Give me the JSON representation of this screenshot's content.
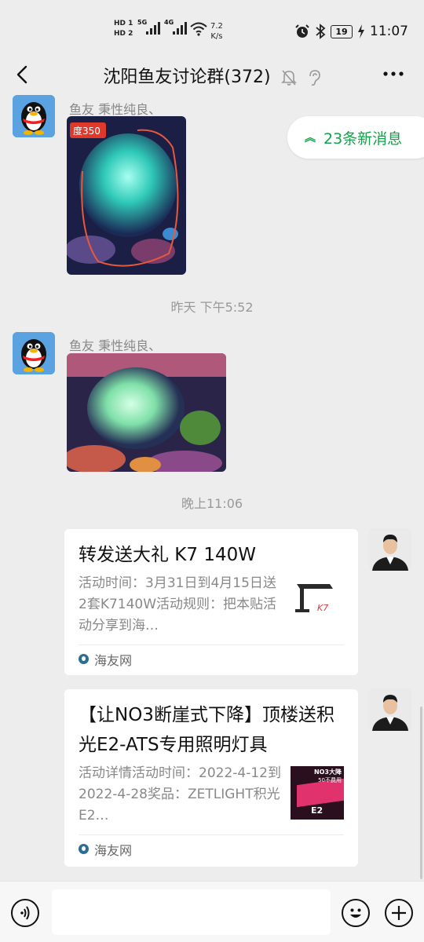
{
  "status_bar": {
    "hd1": "HD 1",
    "hd2": "HD 2",
    "net1": "5G",
    "net2": "4G",
    "speed_value": "7.2",
    "speed_unit": "K/s",
    "battery": "19",
    "time": "11:07"
  },
  "header": {
    "title": "沈阳鱼友讨论群(372)",
    "icons": [
      "back-icon",
      "mute-bell-icon",
      "ear-icon",
      "more-icon"
    ]
  },
  "new_messages_label": "23条新消息",
  "messages": [
    {
      "type": "image",
      "sender": "鱼友 秉性纯良、",
      "image_tag": "度350"
    },
    {
      "type": "time",
      "text": "昨天 下午5:52"
    },
    {
      "type": "image",
      "sender": "鱼友 秉性纯良、"
    },
    {
      "type": "time",
      "text": "晚上11:06"
    },
    {
      "type": "link_card",
      "title": "转发送大礼 K7 140W",
      "desc": "活动时间：3月31日到4月15日送2套K7140W活动规则：把本贴活动分享到海…",
      "source": "海友网"
    },
    {
      "type": "link_card",
      "title": "【让NO3断崖式下降】顶楼送积光E2-ATS专用照明灯具",
      "desc": "活动详情活动时间：2022-4-12到2022-4-28奖品：ZETLIGHT积光E2…",
      "source": "海友网",
      "thumb_text_1": "NO3大降",
      "thumb_text_2": "50不费用",
      "thumb_text_3": "E2"
    }
  ],
  "input": {
    "placeholder": ""
  },
  "colors": {
    "accent_green": "#13a24a",
    "background": "#ededed",
    "card": "#ffffff"
  }
}
